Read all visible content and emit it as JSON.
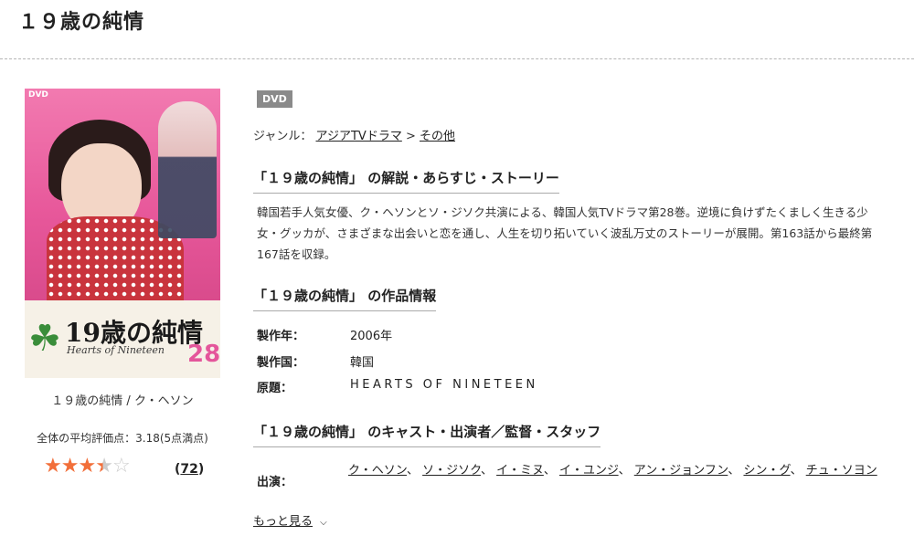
{
  "page": {
    "title": "１９歳の純情"
  },
  "cover": {
    "dvd_mark": "DVD",
    "jp_title": "19歳の純情",
    "en_title": "Hearts of Nineteen",
    "volume": "28",
    "caption": "１９歳の純情 / ク・ヘソン"
  },
  "rating": {
    "label": "全体の平均評価点：3.18(5点満点)",
    "value": 3.18,
    "max": 5,
    "count": "72",
    "star_on_color": "#f26f3a",
    "star_off_color": "#cccccc"
  },
  "badge": "DVD",
  "genre": {
    "label": "ジャンル：",
    "link1": "アジアTVドラマ",
    "sep": ">",
    "link2": "その他"
  },
  "sections": {
    "story_heading": "「１９歳の純情」 の解説・あらすじ・ストーリー",
    "story_text": "韓国若手人気女優、ク・ヘソンとソ・ジソク共演による、韓国人気TVドラマ第28巻。逆境に負けずたくましく生きる少女・グッカが、さまざまな出会いと恋を通し、人生を切り拓いていく波乱万丈のストーリーが展開。第163話から最終第167話を収録。",
    "info_heading": "「１９歳の純情」 の作品情報",
    "cast_heading": "「１９歳の純情」 のキャスト・出演者／監督・スタッフ"
  },
  "info": [
    {
      "label": "製作年：",
      "value": "2006年"
    },
    {
      "label": "製作国：",
      "value": "韓国"
    },
    {
      "label": "原題：",
      "value": "HEARTS OF NINETEEN"
    }
  ],
  "cast": {
    "label": "出演：",
    "names": [
      "ク・ヘソン",
      "ソ・ジソク",
      "イ・ミヌ",
      "イ・ユンジ",
      "アン・ジョンフン",
      "シン・グ",
      "チュ・ソヨン"
    ],
    "separator": "、"
  },
  "more_label": "もっと見る",
  "icons": {
    "clover": "clover-icon",
    "chevron": "chevron-down-icon",
    "star": "star-icon"
  }
}
